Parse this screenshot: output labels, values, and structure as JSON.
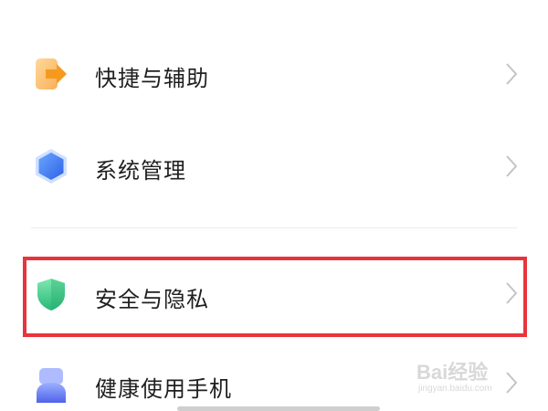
{
  "settings": {
    "items": [
      {
        "label": "快捷与辅助",
        "icon": "shortcut-arrow-icon",
        "icon_color": "#f5a623"
      },
      {
        "label": "系统管理",
        "icon": "hexagon-system-icon",
        "icon_color": "#3f7cf4"
      },
      {
        "label": "安全与隐私",
        "icon": "shield-security-icon",
        "icon_color": "#3ccf8e",
        "highlighted": true
      },
      {
        "label": "健康使用手机",
        "icon": "digital-wellbeing-icon",
        "icon_color": "#5a72f0"
      }
    ]
  },
  "highlight_color": "#e8343c",
  "watermark": {
    "brand": "Bai经验",
    "url": "jingyan.baidu.com"
  }
}
